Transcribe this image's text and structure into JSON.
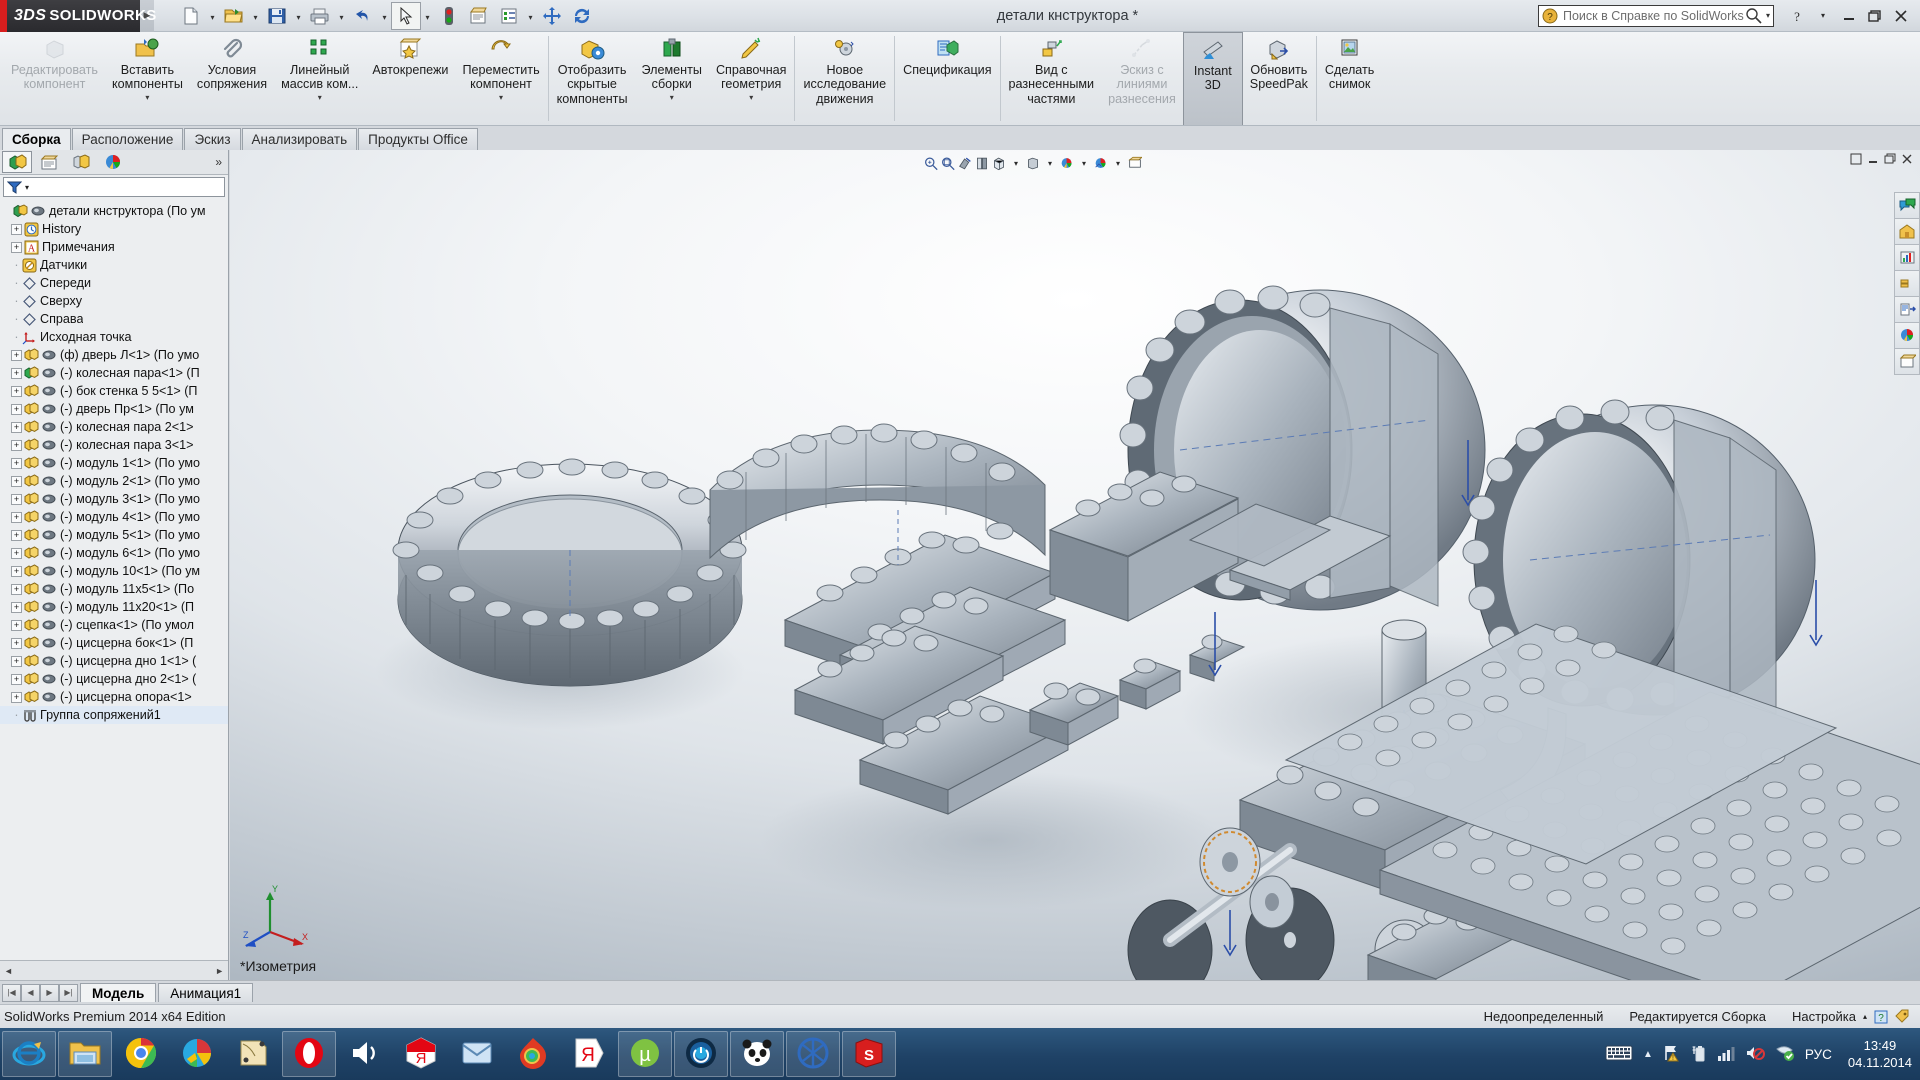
{
  "app": {
    "brand_3ds": "3DS",
    "brand_name": "SOLIDWORKS",
    "title": "детали кнструктора *",
    "status_edition": "SolidWorks Premium 2014 x64 Edition"
  },
  "titlebar": {
    "quick_access": [
      {
        "name": "new-document",
        "icon": "new-file-icon",
        "dropdown": true
      },
      {
        "name": "open-document",
        "icon": "open-folder-icon",
        "dropdown": true
      },
      {
        "name": "save-document",
        "icon": "save-disk-icon",
        "dropdown": true
      },
      {
        "name": "print-document",
        "icon": "printer-icon",
        "dropdown": true
      },
      {
        "name": "undo",
        "icon": "undo-arrow-icon",
        "dropdown": true
      },
      {
        "name": "select",
        "icon": "cursor-arrow-icon",
        "dropdown": true,
        "selected": true
      },
      {
        "name": "rebuild",
        "icon": "traffic-light-icon",
        "dropdown": false
      },
      {
        "name": "file-properties",
        "icon": "document-properties-icon",
        "dropdown": false
      },
      {
        "name": "options",
        "icon": "options-list-icon",
        "dropdown": true
      },
      {
        "name": "move-component",
        "icon": "move-cross-icon",
        "dropdown": false
      },
      {
        "name": "reload",
        "icon": "refresh-arrows-icon",
        "dropdown": false
      }
    ],
    "search_placeholder": "Поиск в Справке по SolidWorks",
    "window_buttons": [
      "help-question-icon",
      "chevron-down-icon",
      "minimize-icon",
      "restore-icon",
      "close-icon"
    ]
  },
  "ribbon": {
    "buttons": [
      {
        "label": "Редактировать\nкомпонент",
        "icon": "edit-component-icon",
        "disabled": true,
        "caret": false
      },
      {
        "label": "Вставить\nкомпоненты",
        "icon": "insert-components-icon",
        "disabled": false,
        "caret": true
      },
      {
        "label": "Условия\nсопряжения",
        "icon": "mate-paperclip-icon",
        "disabled": false,
        "caret": false
      },
      {
        "label": "Линейный\nмассив ком...",
        "icon": "linear-pattern-icon",
        "disabled": false,
        "caret": true
      },
      {
        "label": "Автокрепежи",
        "icon": "smart-fasteners-icon",
        "disabled": false,
        "caret": false
      },
      {
        "label": "Переместить\nкомпонент",
        "icon": "move-component-icon",
        "disabled": false,
        "caret": true
      },
      {
        "separator": true
      },
      {
        "label": "Отобразить\nскрытые\nкомпоненты",
        "icon": "show-hidden-components-icon",
        "disabled": false,
        "caret": false
      },
      {
        "label": "Элементы\nсборки",
        "icon": "assembly-features-icon",
        "disabled": false,
        "caret": true
      },
      {
        "label": "Справочная\nгеометрия",
        "icon": "reference-geometry-icon",
        "disabled": false,
        "caret": true
      },
      {
        "separator": true
      },
      {
        "label": "Новое\nисследование\nдвижения",
        "icon": "new-motion-study-icon",
        "disabled": false,
        "caret": false
      },
      {
        "separator": true
      },
      {
        "label": "Спецификация",
        "icon": "bill-of-materials-icon",
        "disabled": false,
        "caret": false
      },
      {
        "separator": true
      },
      {
        "label": "Вид с\nразнесенными\nчастями",
        "icon": "exploded-view-icon",
        "disabled": false,
        "caret": false
      },
      {
        "label": "Эскиз с\nлиниями\nразнесения",
        "icon": "explode-line-sketch-icon",
        "disabled": true,
        "caret": false
      },
      {
        "label": "Instant\n3D",
        "icon": "instant-3d-icon",
        "disabled": false,
        "caret": false,
        "active": true
      },
      {
        "label": "Обновить\nSpeedPak",
        "icon": "update-speedpak-icon",
        "disabled": false,
        "caret": false
      },
      {
        "separator": true
      },
      {
        "label": "Сделать\nснимок",
        "icon": "take-snapshot-icon",
        "disabled": false,
        "caret": false
      }
    ]
  },
  "command_tabs": [
    {
      "label": "Сборка",
      "selected": true
    },
    {
      "label": "Расположение",
      "selected": false
    },
    {
      "label": "Эскиз",
      "selected": false
    },
    {
      "label": "Анализировать",
      "selected": false
    },
    {
      "label": "Продукты Office",
      "selected": false
    }
  ],
  "left_panel": {
    "tabs": [
      {
        "name": "feature-manager-tab",
        "icon": "feature-tree-icon",
        "selected": true
      },
      {
        "name": "property-manager-tab",
        "icon": "property-manager-icon",
        "selected": false
      },
      {
        "name": "configuration-manager-tab",
        "icon": "configuration-manager-icon",
        "selected": false
      },
      {
        "name": "display-manager-tab",
        "icon": "display-manager-icon",
        "selected": false
      }
    ],
    "expand_chevron": "»",
    "filter_icon": "filter-funnel-icon",
    "tree": [
      {
        "label": "детали кнструктора  (По ум",
        "icon": "assembly-icon",
        "expandable": false,
        "indent": 0,
        "root": true
      },
      {
        "label": "History",
        "icon": "history-clock-icon",
        "expandable": true,
        "indent": 1
      },
      {
        "label": "Примечания",
        "icon": "annotations-a-icon",
        "expandable": true,
        "indent": 1
      },
      {
        "label": "Датчики",
        "icon": "sensors-icon",
        "expandable": false,
        "indent": 1
      },
      {
        "label": "Спереди",
        "icon": "plane-icon",
        "expandable": false,
        "indent": 1
      },
      {
        "label": "Сверху",
        "icon": "plane-icon",
        "expandable": false,
        "indent": 1
      },
      {
        "label": "Справа",
        "icon": "plane-icon",
        "expandable": false,
        "indent": 1
      },
      {
        "label": "Исходная точка",
        "icon": "origin-icon",
        "expandable": false,
        "indent": 1
      },
      {
        "label": "(ф) дверь Л<1> (По умо",
        "icon": "part-icon",
        "expandable": true,
        "indent": 1
      },
      {
        "label": "(-) колесная пара<1> (П",
        "icon": "part-green-icon",
        "expandable": true,
        "indent": 1
      },
      {
        "label": "(-) бок стенка 5 5<1> (П",
        "icon": "part-icon",
        "expandable": true,
        "indent": 1
      },
      {
        "label": "(-) дверь Пр<1> (По ум",
        "icon": "part-icon",
        "expandable": true,
        "indent": 1
      },
      {
        "label": "(-) колесная пара 2<1>",
        "icon": "part-icon",
        "expandable": true,
        "indent": 1
      },
      {
        "label": "(-) колесная пара 3<1>",
        "icon": "part-icon",
        "expandable": true,
        "indent": 1
      },
      {
        "label": "(-) модуль 1<1> (По умо",
        "icon": "part-icon",
        "expandable": true,
        "indent": 1
      },
      {
        "label": "(-) модуль 2<1> (По умо",
        "icon": "part-icon",
        "expandable": true,
        "indent": 1
      },
      {
        "label": "(-) модуль 3<1> (По умо",
        "icon": "part-icon",
        "expandable": true,
        "indent": 1
      },
      {
        "label": "(-) модуль 4<1> (По умо",
        "icon": "part-icon",
        "expandable": true,
        "indent": 1
      },
      {
        "label": "(-) модуль 5<1> (По умо",
        "icon": "part-icon",
        "expandable": true,
        "indent": 1
      },
      {
        "label": "(-) модуль 6<1> (По умо",
        "icon": "part-icon",
        "expandable": true,
        "indent": 1
      },
      {
        "label": "(-) модуль 10<1> (По ум",
        "icon": "part-icon",
        "expandable": true,
        "indent": 1
      },
      {
        "label": "(-) модуль 11x5<1> (По",
        "icon": "part-icon",
        "expandable": true,
        "indent": 1
      },
      {
        "label": "(-) модуль 11x20<1> (П",
        "icon": "part-icon",
        "expandable": true,
        "indent": 1
      },
      {
        "label": "(-) сцепка<1> (По умол",
        "icon": "part-icon",
        "expandable": true,
        "indent": 1
      },
      {
        "label": "(-) цисцерна бок<1> (П",
        "icon": "part-icon",
        "expandable": true,
        "indent": 1
      },
      {
        "label": "(-) цисцерна дно 1<1> (",
        "icon": "part-icon",
        "expandable": true,
        "indent": 1
      },
      {
        "label": "(-) цисцерна дно 2<1> (",
        "icon": "part-icon",
        "expandable": true,
        "indent": 1
      },
      {
        "label": "(-) цисцерна опора<1>",
        "icon": "part-icon",
        "expandable": true,
        "indent": 1
      },
      {
        "label": "Группа сопряжений1",
        "icon": "mates-folder-icon",
        "expandable": false,
        "indent": 1,
        "selected": true
      }
    ]
  },
  "graphics": {
    "view_label": "*Изометрия",
    "hud_tools": [
      {
        "name": "zoom-to-area-icon"
      },
      {
        "name": "zoom-to-fit-icon"
      },
      {
        "name": "section-view-icon"
      },
      {
        "name": "view-orientation-icon"
      },
      {
        "name": "display-style-icon",
        "caret": true
      },
      {
        "name": "hide-show-items-icon",
        "caret": true
      },
      {
        "name": "edit-appearance-icon",
        "caret": true
      },
      {
        "name": "apply-scene-icon",
        "caret": true
      },
      {
        "name": "view-settings-icon"
      }
    ],
    "right_toolbar": [
      {
        "name": "solidworks-resources-icon"
      },
      {
        "name": "design-library-icon"
      },
      {
        "name": "file-explorer-icon"
      },
      {
        "name": "view-palette-icon"
      },
      {
        "name": "appearances-scenes-icon"
      },
      {
        "name": "custom-properties-icon"
      }
    ],
    "triad_axes": [
      "X",
      "Y",
      "Z"
    ],
    "window_controls": [
      "restore-small-icon",
      "minimize-small-icon",
      "maximize-small-icon",
      "close-small-icon"
    ]
  },
  "sheet_bar": {
    "nav_buttons": [
      "first-icon",
      "prev-icon",
      "next-icon",
      "last-icon"
    ],
    "sheets": [
      {
        "label": "Модель",
        "selected": true
      },
      {
        "label": "Анимация1",
        "selected": false
      }
    ]
  },
  "status_bar": {
    "left": "SolidWorks Premium 2014 x64 Edition",
    "items": [
      "Недоопределенный",
      "Редактируется Сборка",
      "Настройка"
    ],
    "icons": [
      "up-caret-icon",
      "help-blue-icon",
      "tag-icon"
    ]
  },
  "taskbar": {
    "items": [
      {
        "name": "internet-explorer",
        "icon": "ie-icon",
        "framed": true
      },
      {
        "name": "file-explorer",
        "icon": "folder-icon",
        "framed": true
      },
      {
        "name": "google-chrome",
        "icon": "chrome-icon",
        "framed": false
      },
      {
        "name": "media-player",
        "icon": "colorwheel-icon",
        "framed": false
      },
      {
        "name": "notes-app",
        "icon": "sticky-notes-icon",
        "framed": false
      },
      {
        "name": "opera",
        "icon": "opera-o-icon",
        "framed": true
      },
      {
        "name": "volume-app",
        "icon": "speaker-icon",
        "framed": false
      },
      {
        "name": "yandex-browser",
        "icon": "yandex-y-icon",
        "framed": false
      },
      {
        "name": "mail-client",
        "icon": "envelope-icon",
        "framed": false
      },
      {
        "name": "download-manager",
        "icon": "flame-globe-icon",
        "framed": false
      },
      {
        "name": "yandex-disk",
        "icon": "yandex-ya-icon",
        "framed": false
      },
      {
        "name": "utorrent",
        "icon": "utorrent-icon",
        "framed": true
      },
      {
        "name": "daemon-tools",
        "icon": "daemon-tools-icon",
        "framed": true
      },
      {
        "name": "panda-antivirus",
        "icon": "panda-icon",
        "framed": true
      },
      {
        "name": "kaspersky",
        "icon": "kaspersky-k-icon",
        "framed": true
      },
      {
        "name": "solidworks-window",
        "icon": "solidworks-sw-icon",
        "framed": true
      }
    ],
    "tray": {
      "keyboard_icon": "keyboard-icon",
      "expand_icon": "up-caret-icon",
      "icons": [
        "network-warning-icon",
        "battery-icon",
        "signal-bars-icon",
        "volume-muted-icon",
        "shield-check-icon"
      ],
      "language": "РУС",
      "time": "13:49",
      "date": "04.11.2014"
    }
  }
}
